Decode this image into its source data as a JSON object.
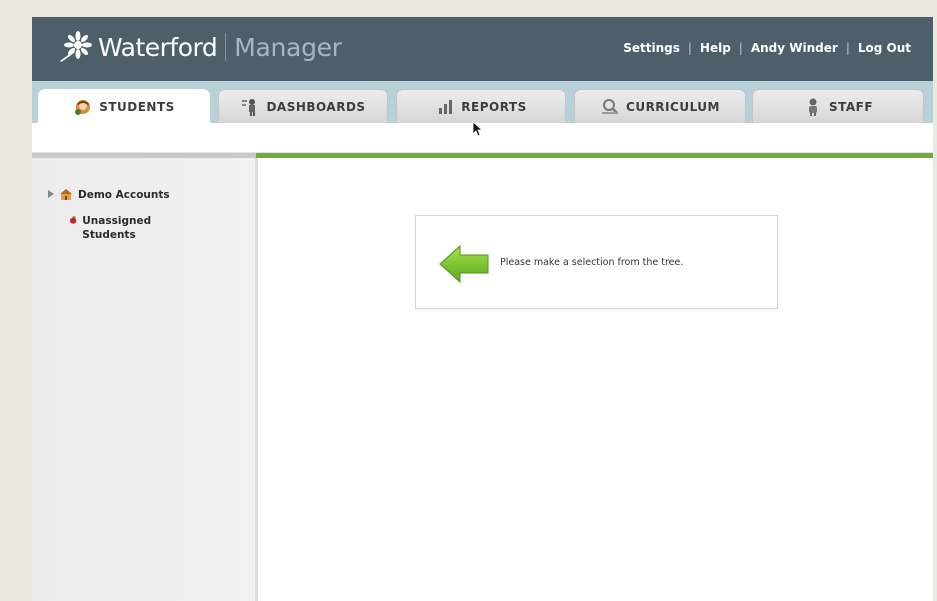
{
  "app": {
    "brand": "Waterford",
    "product": "Manager"
  },
  "user_nav": {
    "settings": "Settings",
    "help": "Help",
    "user": "Andy Winder",
    "logout": "Log Out"
  },
  "tabs": [
    {
      "label": "STUDENTS",
      "icon": "students-icon",
      "active": true
    },
    {
      "label": "DASHBOARDS",
      "icon": "dashboards-icon",
      "active": false
    },
    {
      "label": "REPORTS",
      "icon": "reports-icon",
      "active": false
    },
    {
      "label": "CURRICULUM",
      "icon": "curriculum-icon",
      "active": false
    },
    {
      "label": "STAFF",
      "icon": "staff-icon",
      "active": false
    }
  ],
  "tree": {
    "items": [
      {
        "label": "Demo Accounts",
        "icon": "school-icon"
      },
      {
        "label": "Unassigned Students",
        "icon": "apple-icon"
      }
    ]
  },
  "main": {
    "message": "Please make a selection from the tree."
  },
  "colors": {
    "header": "#4d5f6a",
    "tabbar": "#b8d1d9",
    "accent_green": "#6fae35"
  }
}
